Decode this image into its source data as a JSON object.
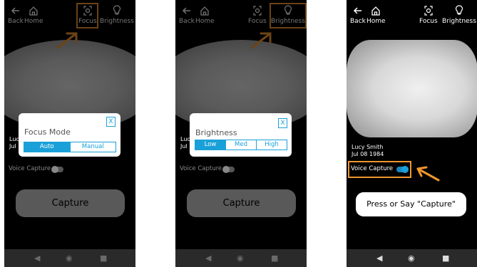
{
  "nav": {
    "back": "Back",
    "home": "Home",
    "focus": "Focus",
    "brightness": "Brightness"
  },
  "patient": {
    "name": "Lucy Smith",
    "dob": "Jul 08 1984",
    "name_partial": "Luc",
    "dob_partial": "Jul"
  },
  "voice_capture": "Voice Capture",
  "capture_label": "Capture",
  "focus_dialog": {
    "title": "Focus Mode",
    "close": "X",
    "options": [
      "Auto",
      "Manual"
    ],
    "selected": "Auto"
  },
  "brightness_dialog": {
    "title": "Brightness",
    "close": "X",
    "options": [
      "Low",
      "Med",
      "High"
    ],
    "selected": "Low"
  },
  "tip": "Press or Say \"Capture\"",
  "colors": {
    "highlight": "#f0962f",
    "accent": "#1aa0d8"
  }
}
